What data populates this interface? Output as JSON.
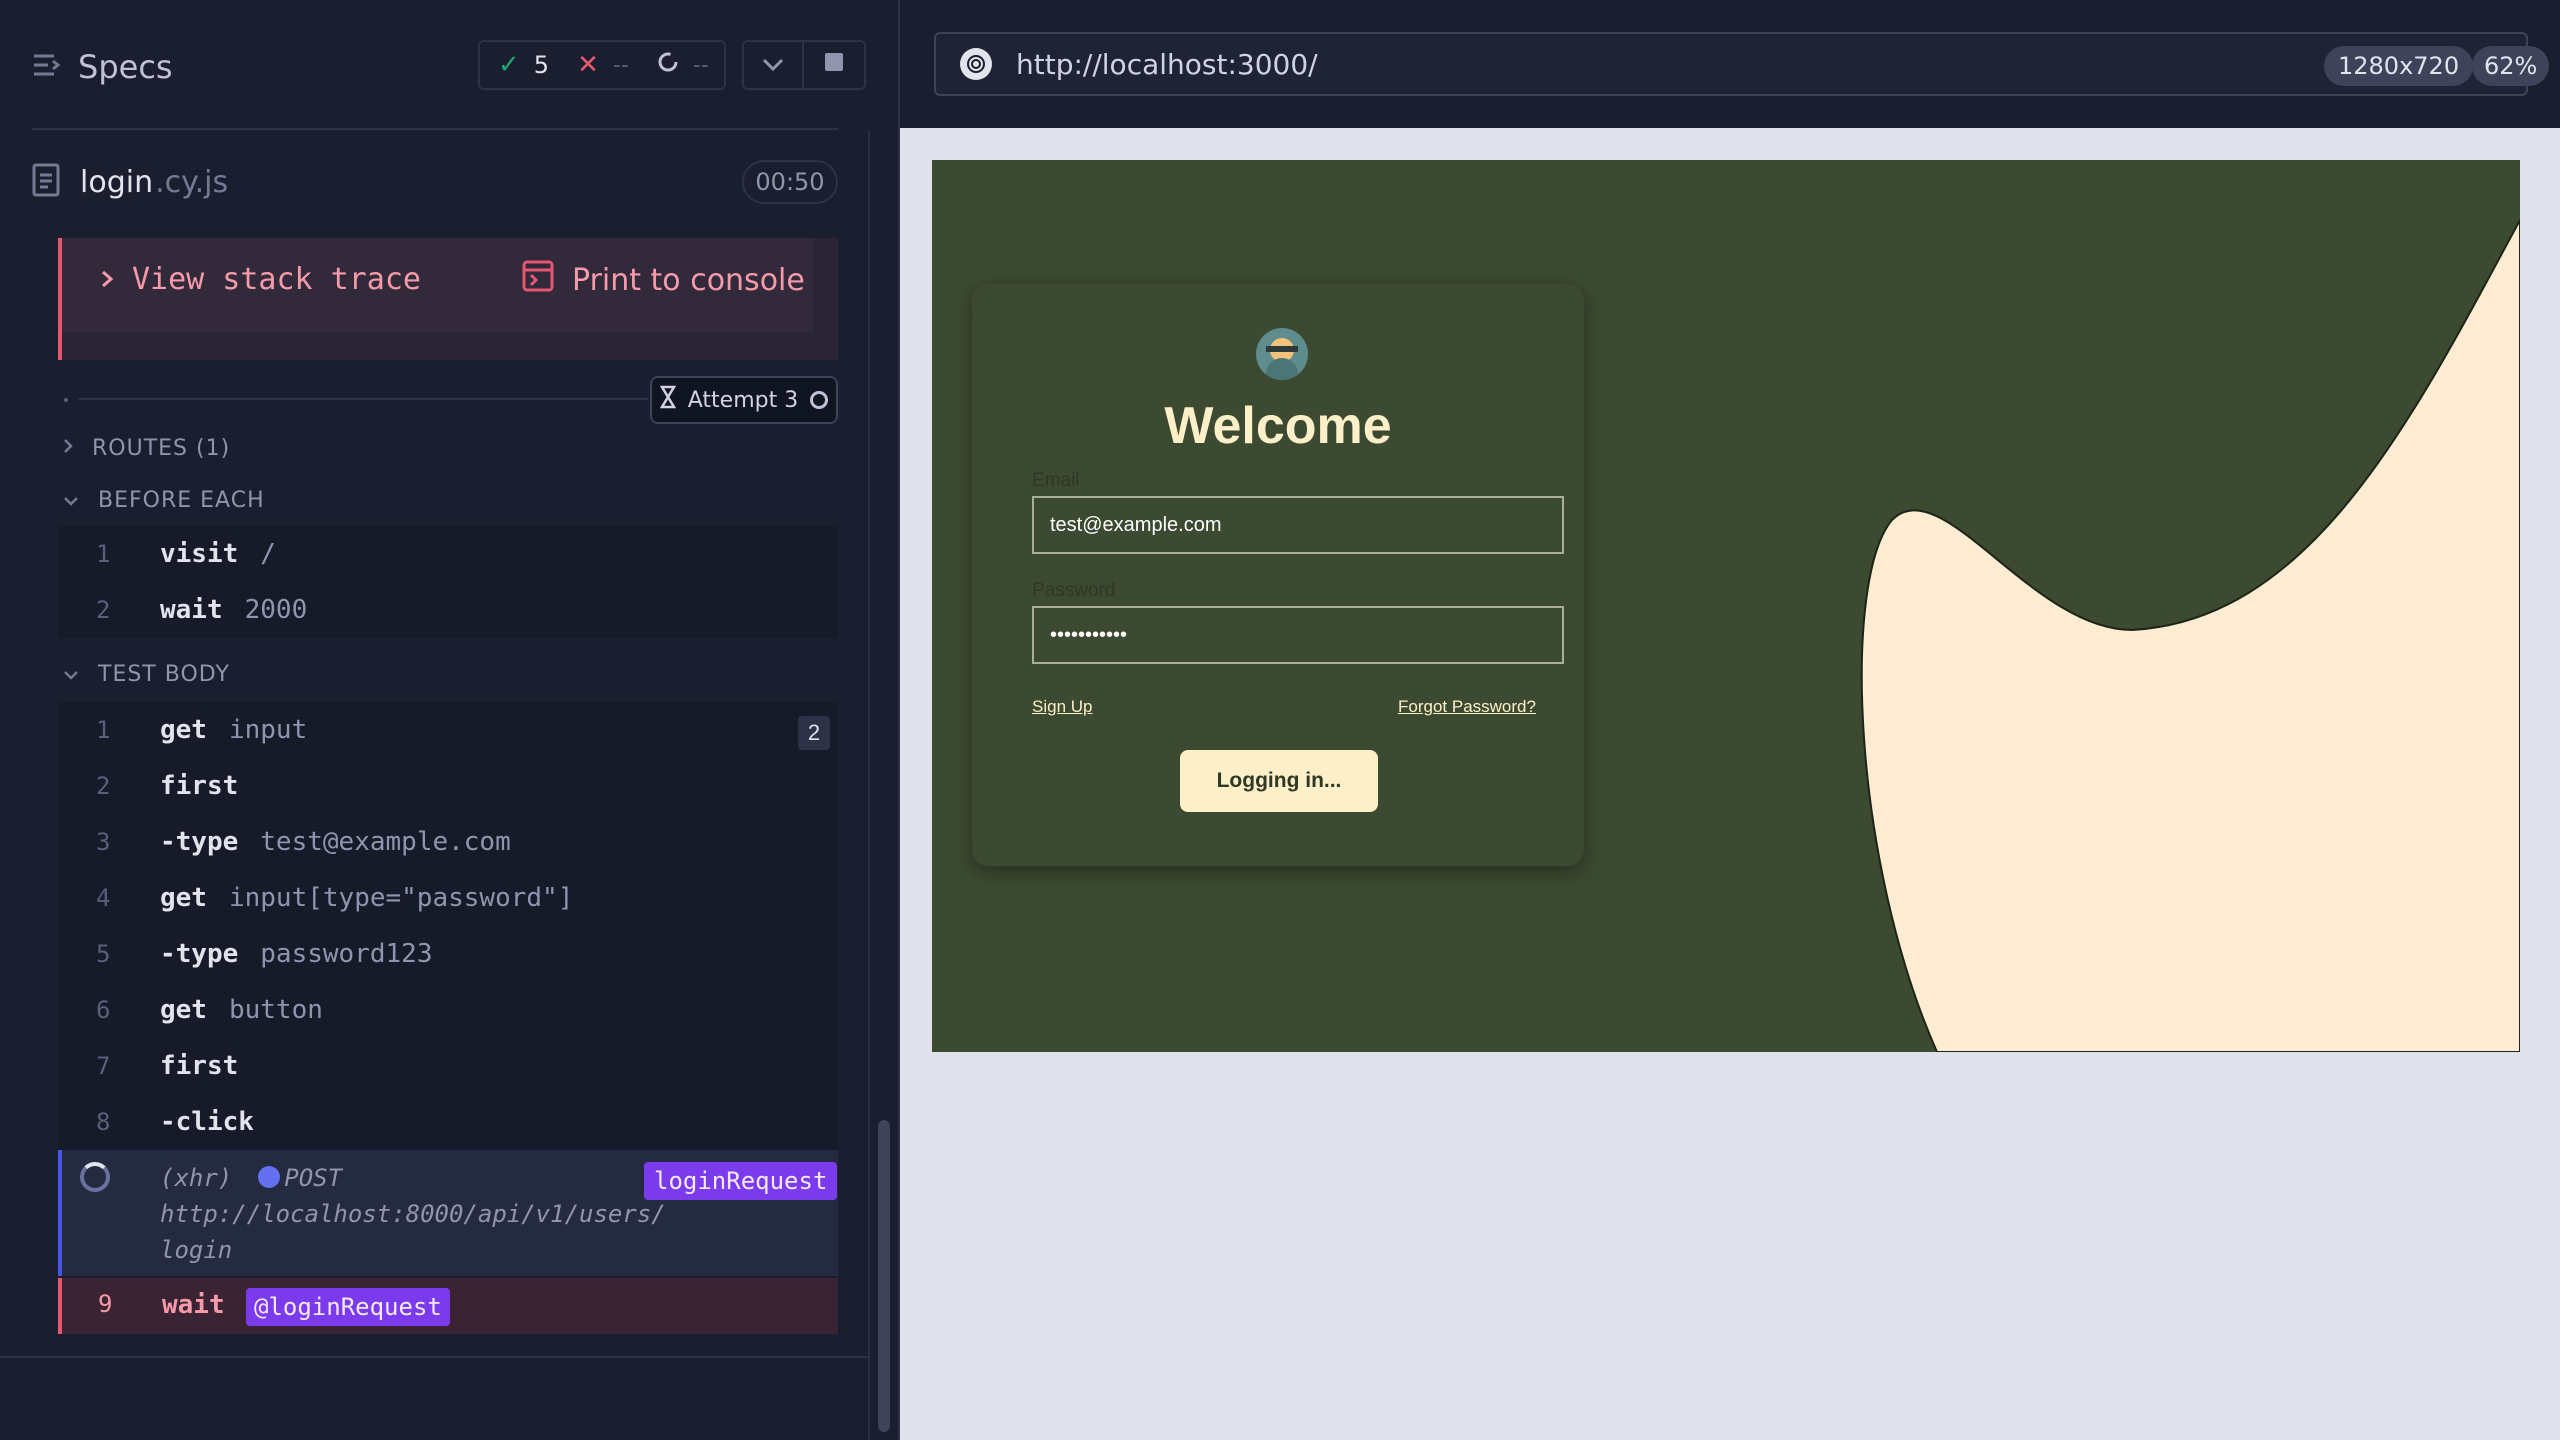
{
  "header": {
    "specs_label": "Specs",
    "passed_count": "5",
    "failed_count": "--",
    "pending_count": "--"
  },
  "spec": {
    "name": "login",
    "ext": ".cy.js",
    "duration": "00:50"
  },
  "error": {
    "stack_trace_label": "View stack trace",
    "print_label": "Print to console"
  },
  "attempt": {
    "label": "Attempt 3"
  },
  "routes_label": "ROUTES (1)",
  "before_each": {
    "label": "BEFORE EACH",
    "commands": [
      {
        "num": "1",
        "cmd": "visit",
        "arg": "/"
      },
      {
        "num": "2",
        "cmd": "wait",
        "arg": "2000"
      }
    ]
  },
  "test_body": {
    "label": "TEST BODY",
    "commands": [
      {
        "num": "1",
        "cmd": "get",
        "arg": "input",
        "badge": "2"
      },
      {
        "num": "2",
        "cmd": "first",
        "arg": ""
      },
      {
        "num": "3",
        "cmd": "-type",
        "arg": "test@example.com"
      },
      {
        "num": "4",
        "cmd": "get",
        "arg": "input[type=\"password\"]"
      },
      {
        "num": "5",
        "cmd": "-type",
        "arg": "password123"
      },
      {
        "num": "6",
        "cmd": "get",
        "arg": "button"
      },
      {
        "num": "7",
        "cmd": "first",
        "arg": ""
      },
      {
        "num": "8",
        "cmd": "-click",
        "arg": ""
      }
    ]
  },
  "xhr": {
    "prefix": "(xhr)",
    "method": "POST",
    "url": "http://localhost:8000/api/v1/users/login",
    "alias": "loginRequest"
  },
  "wait_row": {
    "num": "9",
    "cmd": "wait",
    "alias": "@loginRequest"
  },
  "browser": {
    "url": "http://localhost:3000/",
    "viewport": "1280x720",
    "zoom": "62%"
  },
  "app": {
    "title": "Welcome",
    "email_label": "Email",
    "email_value": "test@example.com",
    "password_label": "Password",
    "password_value": "•••••••••••",
    "signup_label": "Sign Up",
    "forgot_label": "Forgot Password?",
    "login_button": "Logging in..."
  },
  "colors": {
    "pass": "#1fa971",
    "fail": "#ec5b6d",
    "alias": "#7c3aed",
    "app_bg": "#3c4a31",
    "app_accent": "#fdefc8"
  }
}
